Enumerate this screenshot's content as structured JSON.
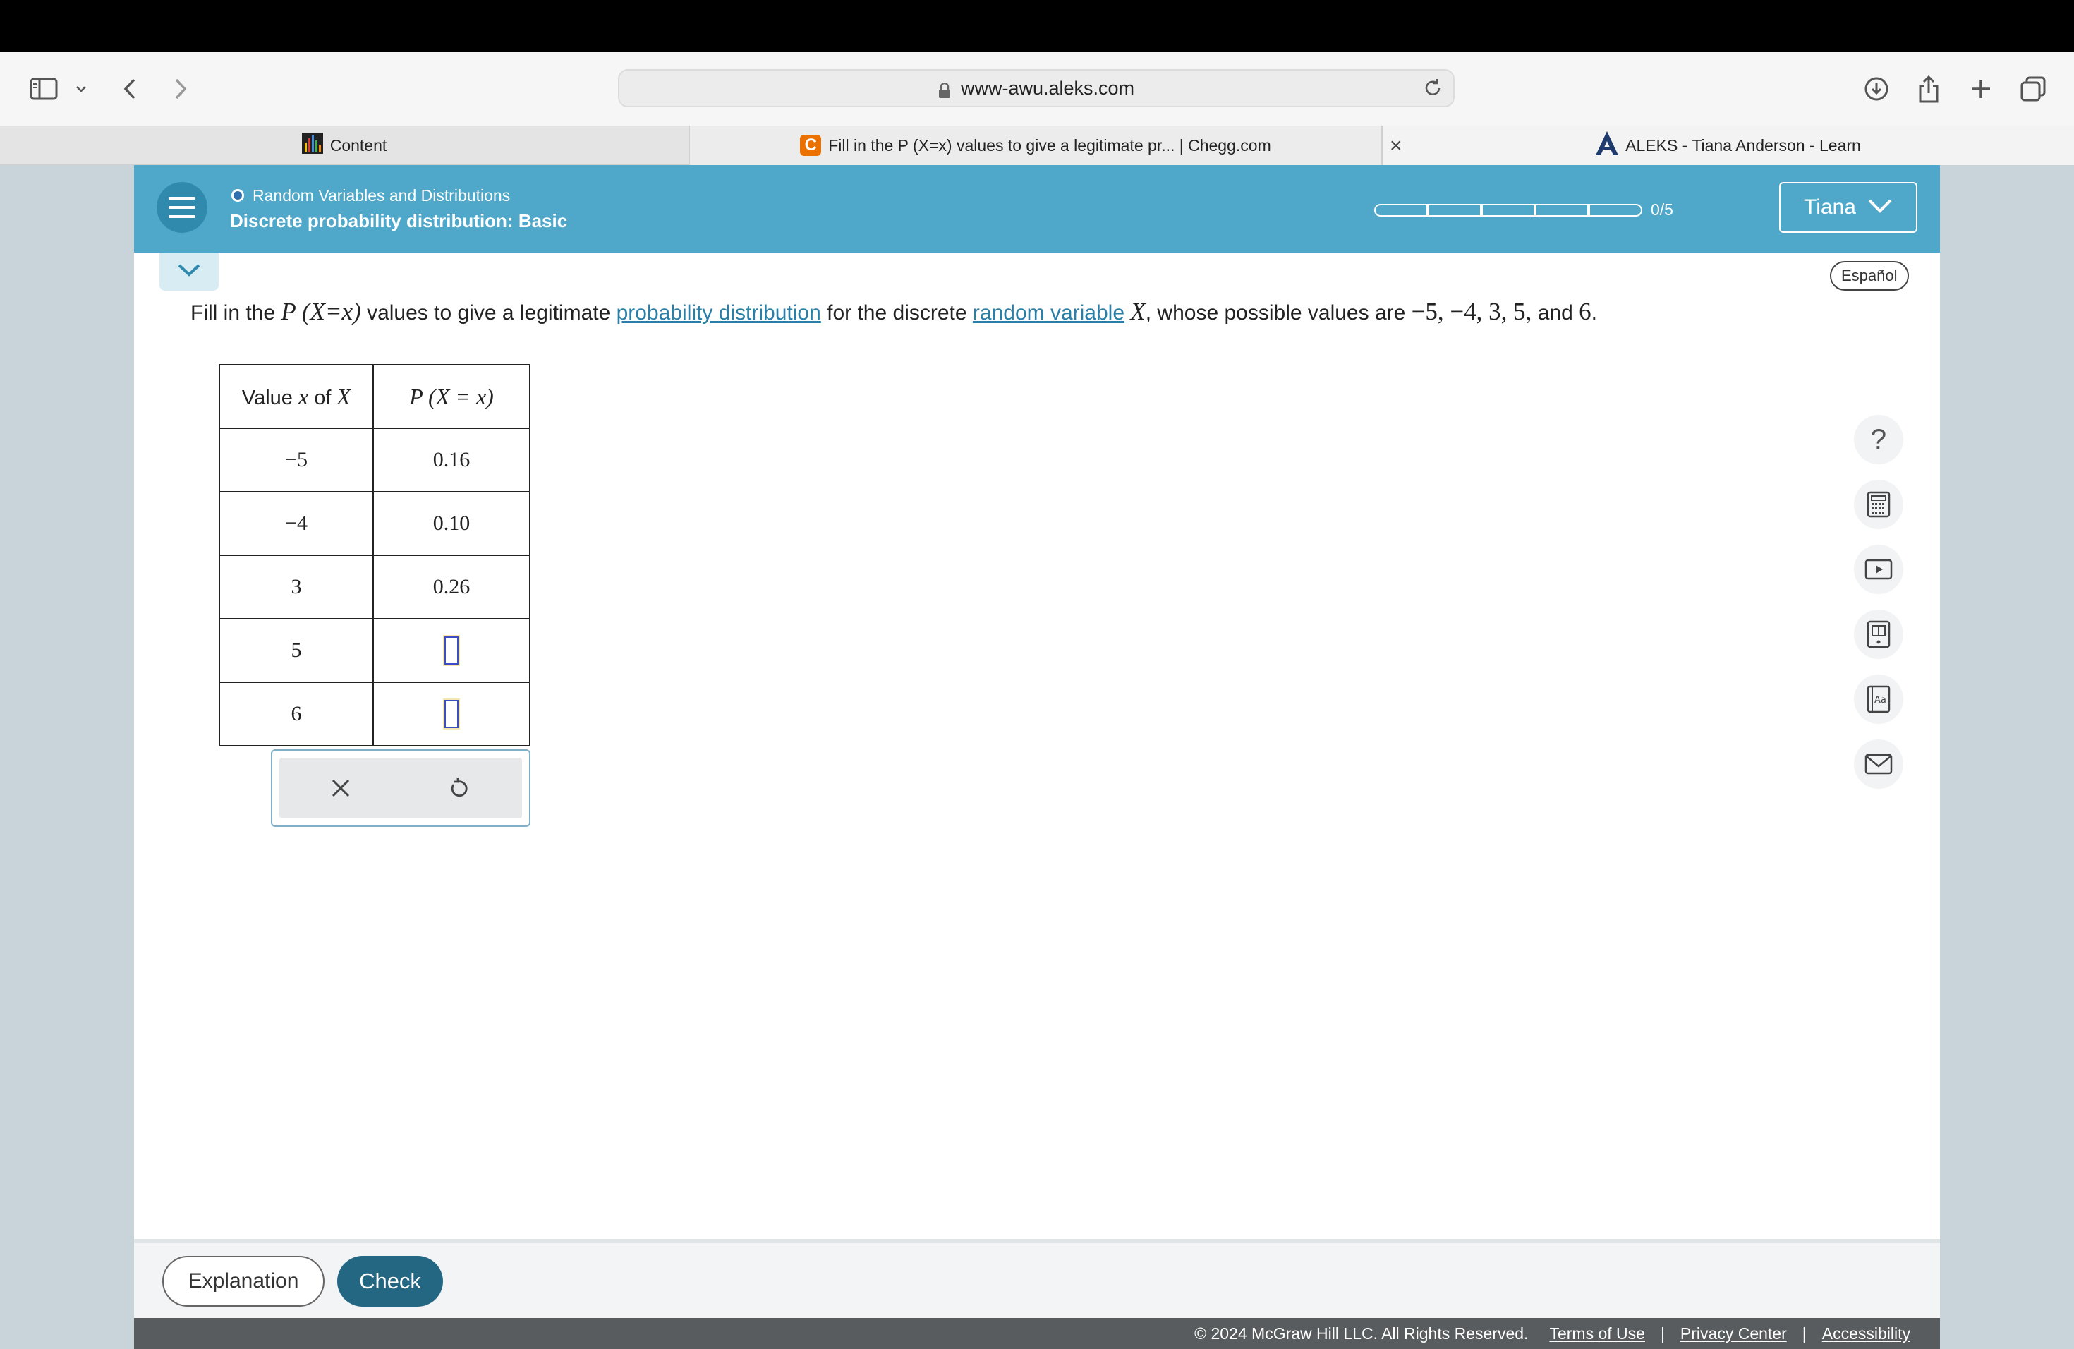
{
  "browser": {
    "url": "www-awu.aleks.com",
    "tabs": [
      {
        "label": "Content",
        "icon": "chart-favicon-icon"
      },
      {
        "label": "Fill in the P (X=x) values to give a legitimate pr... | Chegg.com",
        "icon": "chegg-favicon-icon"
      },
      {
        "label": "ALEKS - Tiana Anderson - Learn",
        "icon": "aleks-favicon-icon"
      }
    ]
  },
  "header": {
    "topic": "Random Variables and Distributions",
    "subtopic": "Discrete probability distribution: Basic",
    "progress_text": "0/5",
    "progress_filled": 0,
    "progress_total": 5,
    "user_name": "Tiana",
    "language_button": "Español"
  },
  "question": {
    "part1": "Fill in the",
    "math1": "P (X=x)",
    "part2": "values to give a legitimate",
    "link1": "probability distribution",
    "part3": "for the discrete",
    "link2": "random variable",
    "var": "X",
    "part4": ", whose possible values are",
    "values_text": "−5, −4, 3, 5,",
    "and": "and",
    "last_value": "6",
    "end": "."
  },
  "table": {
    "header_value_prefix": "Value",
    "header_value_x": "x",
    "header_value_of": "of",
    "header_value_X": "X",
    "header_prob": "P (X = x)",
    "rows": [
      {
        "x": "−5",
        "p": "0.16"
      },
      {
        "x": "−4",
        "p": "0.10"
      },
      {
        "x": "3",
        "p": "0.26"
      },
      {
        "x": "5",
        "p": ""
      },
      {
        "x": "6",
        "p": ""
      }
    ]
  },
  "buttons": {
    "explanation": "Explanation",
    "check": "Check"
  },
  "footer": {
    "copyright": "© 2024 McGraw Hill LLC. All Rights Reserved.",
    "terms": "Terms of Use",
    "privacy": "Privacy Center",
    "accessibility": "Accessibility",
    "separator": "|"
  },
  "colors": {
    "header_blue": "#4fa8c9",
    "check_button": "#246782",
    "link": "#2a7fa8"
  }
}
